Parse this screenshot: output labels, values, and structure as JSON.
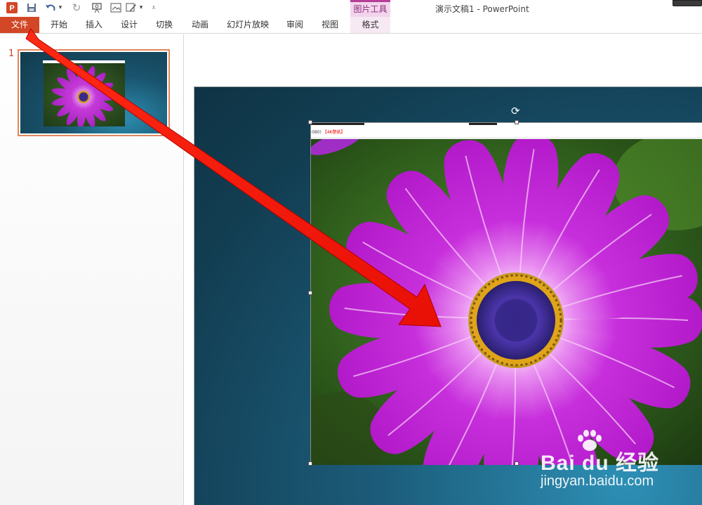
{
  "window": {
    "title": "演示文稿1 - PowerPoint"
  },
  "quick_access": {
    "items": [
      {
        "name": "powerpoint-logo-icon",
        "glyph": "P"
      },
      {
        "name": "save-icon",
        "glyph": "💾"
      },
      {
        "name": "undo-icon",
        "glyph": "↶"
      },
      {
        "name": "undo-dropdown-icon",
        "glyph": "▾"
      },
      {
        "name": "redo-icon",
        "glyph": "↻"
      },
      {
        "name": "presentation-icon",
        "glyph": "⊡"
      },
      {
        "name": "picture-icon",
        "glyph": "▣"
      },
      {
        "name": "draw-icon",
        "glyph": "✎"
      },
      {
        "name": "draw-dropdown-icon",
        "glyph": "▾"
      },
      {
        "name": "customize-qat-icon",
        "glyph": "⩡"
      }
    ]
  },
  "contextual_tab_group": {
    "label": "图片工具"
  },
  "ribbon": {
    "tabs": [
      {
        "label": "文件"
      },
      {
        "label": "开始"
      },
      {
        "label": "插入"
      },
      {
        "label": "设计"
      },
      {
        "label": "切换"
      },
      {
        "label": "动画"
      },
      {
        "label": "幻灯片放映"
      },
      {
        "label": "审阅"
      },
      {
        "label": "视图"
      },
      {
        "label": "格式"
      }
    ]
  },
  "thumbnails": {
    "slide_number": "1"
  },
  "picture": {
    "header_text": "080)",
    "header_tag": "【4K壁纸】"
  },
  "watermark": {
    "brand": "Bai du 经验",
    "url": "jingyan.baidu.com"
  },
  "colors": {
    "file_tab": "#d24726",
    "contextual_accent": "#b43e98",
    "arrow": "#ff1a0a",
    "slide_bg": "#17495f"
  }
}
